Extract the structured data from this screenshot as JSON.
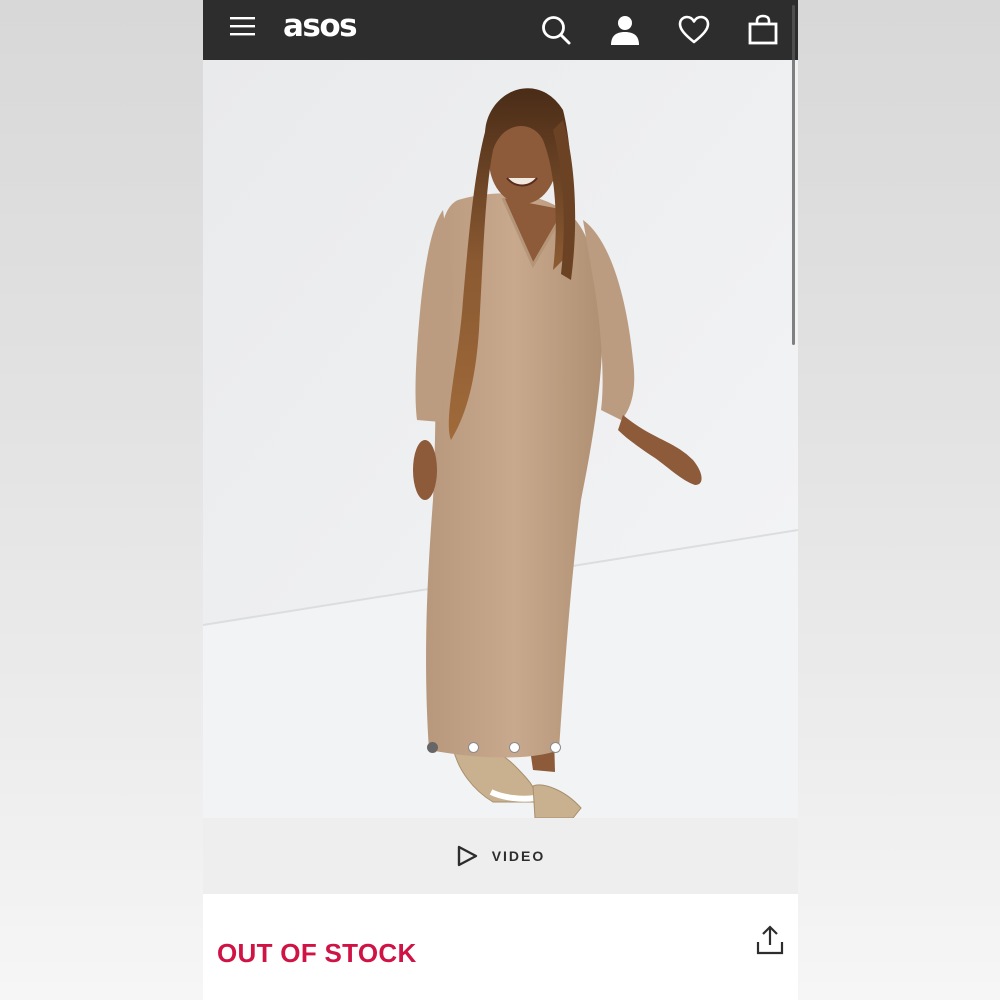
{
  "header": {
    "logo": "asos",
    "icons": [
      "menu-icon",
      "search-icon",
      "account-icon",
      "heart-icon",
      "bag-icon"
    ],
    "background": "#2d2d2d"
  },
  "gallery": {
    "image_count": 4,
    "active_index": 0,
    "product_color": "#c4a488"
  },
  "video": {
    "label": "VIDEO"
  },
  "status": {
    "text": "OUT OF STOCK",
    "color": "#d01345"
  }
}
